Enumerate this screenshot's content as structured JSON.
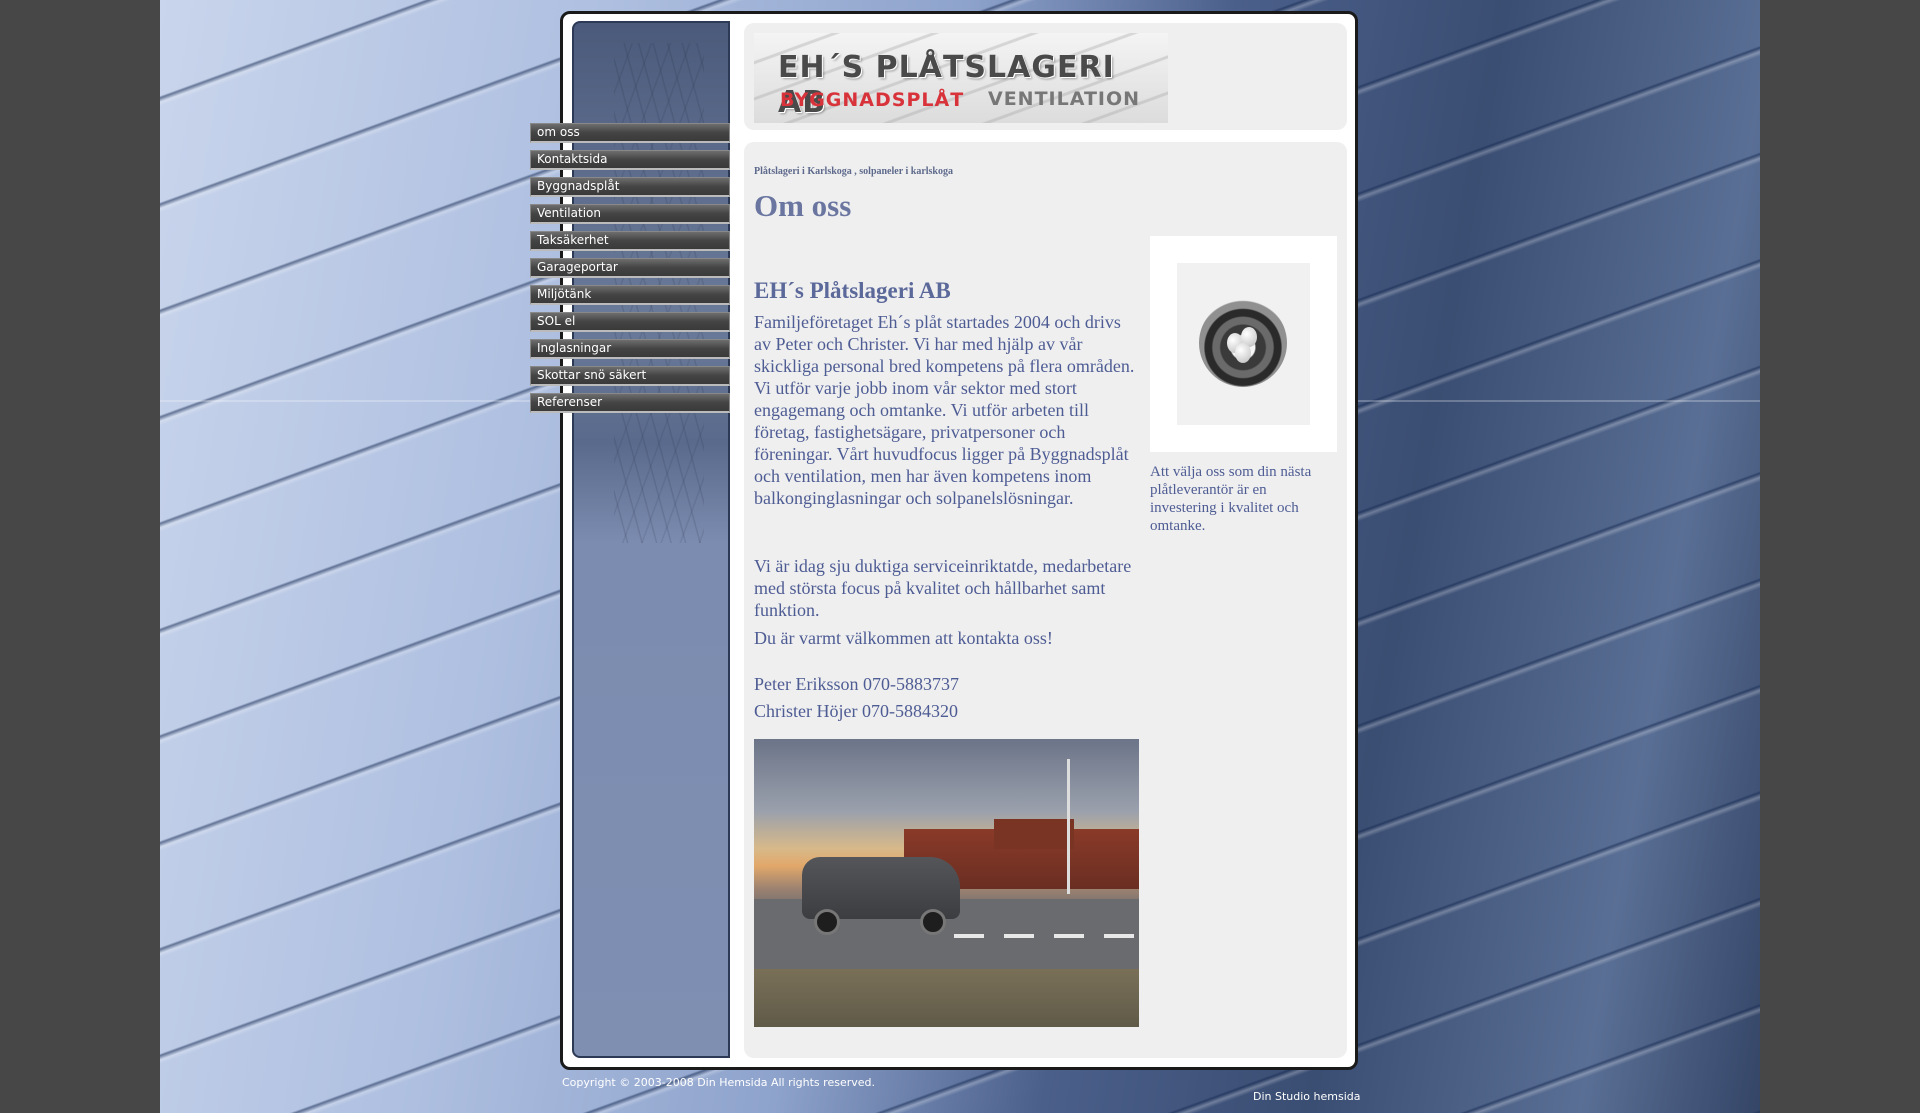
{
  "logo": {
    "line1": "EH´S PLÅTSLAGERI AB",
    "line2": "BYGGNADSPLÅT",
    "line3": "VENTILATION"
  },
  "nav": {
    "items": [
      {
        "label": "om oss"
      },
      {
        "label": "Kontaktsida"
      },
      {
        "label": "Byggnadsplåt"
      },
      {
        "label": "Ventilation"
      },
      {
        "label": "Taksäkerhet"
      },
      {
        "label": "Garageportar"
      },
      {
        "label": "Miljötänk"
      },
      {
        "label": "SOL el"
      },
      {
        "label": "Inglasningar"
      },
      {
        "label": "Skottar snö säkert"
      },
      {
        "label": "Referenser"
      }
    ]
  },
  "main": {
    "breadcrumb": "Plåtslageri i Karlskoga , solpaneler i karlskoga",
    "title": "Om oss",
    "company_heading": "EH´s Plåtslageri AB",
    "paragraph1": "Familjeföretaget Eh´s plåt startades 2004 och drivs av Peter och Christer. Vi har med hjälp av vår skickliga personal bred kompetens på flera områden. Vi utför varje jobb inom vår sektor med stort engagemang och omtanke. Vi utför arbeten till företag, fastighetsägare, privatpersoner och föreningar. Vårt huvudfocus ligger på Byggnadsplåt och ventilation, men har även kompetens inom balkonginglasningar och solpanelslösningar.",
    "paragraph2": "Vi är idag sju duktiga serviceinriktatde, medarbetare med största focus på kvalitet och hållbarhet samt funktion.",
    "paragraph3": "Du är varmt välkommen att kontakta oss!",
    "contact1": "Peter Eriksson 070-5883737",
    "contact2": "Christer Höjer 070-5884320",
    "side_caption": "Att välja oss som din nästa plåtleverantör är en investering i kvalitet och omtanke."
  },
  "footer": {
    "copyright": "Copyright © 2003-2008 Din Hemsida All rights reserved.",
    "studio": "Din Studio hemsida"
  }
}
